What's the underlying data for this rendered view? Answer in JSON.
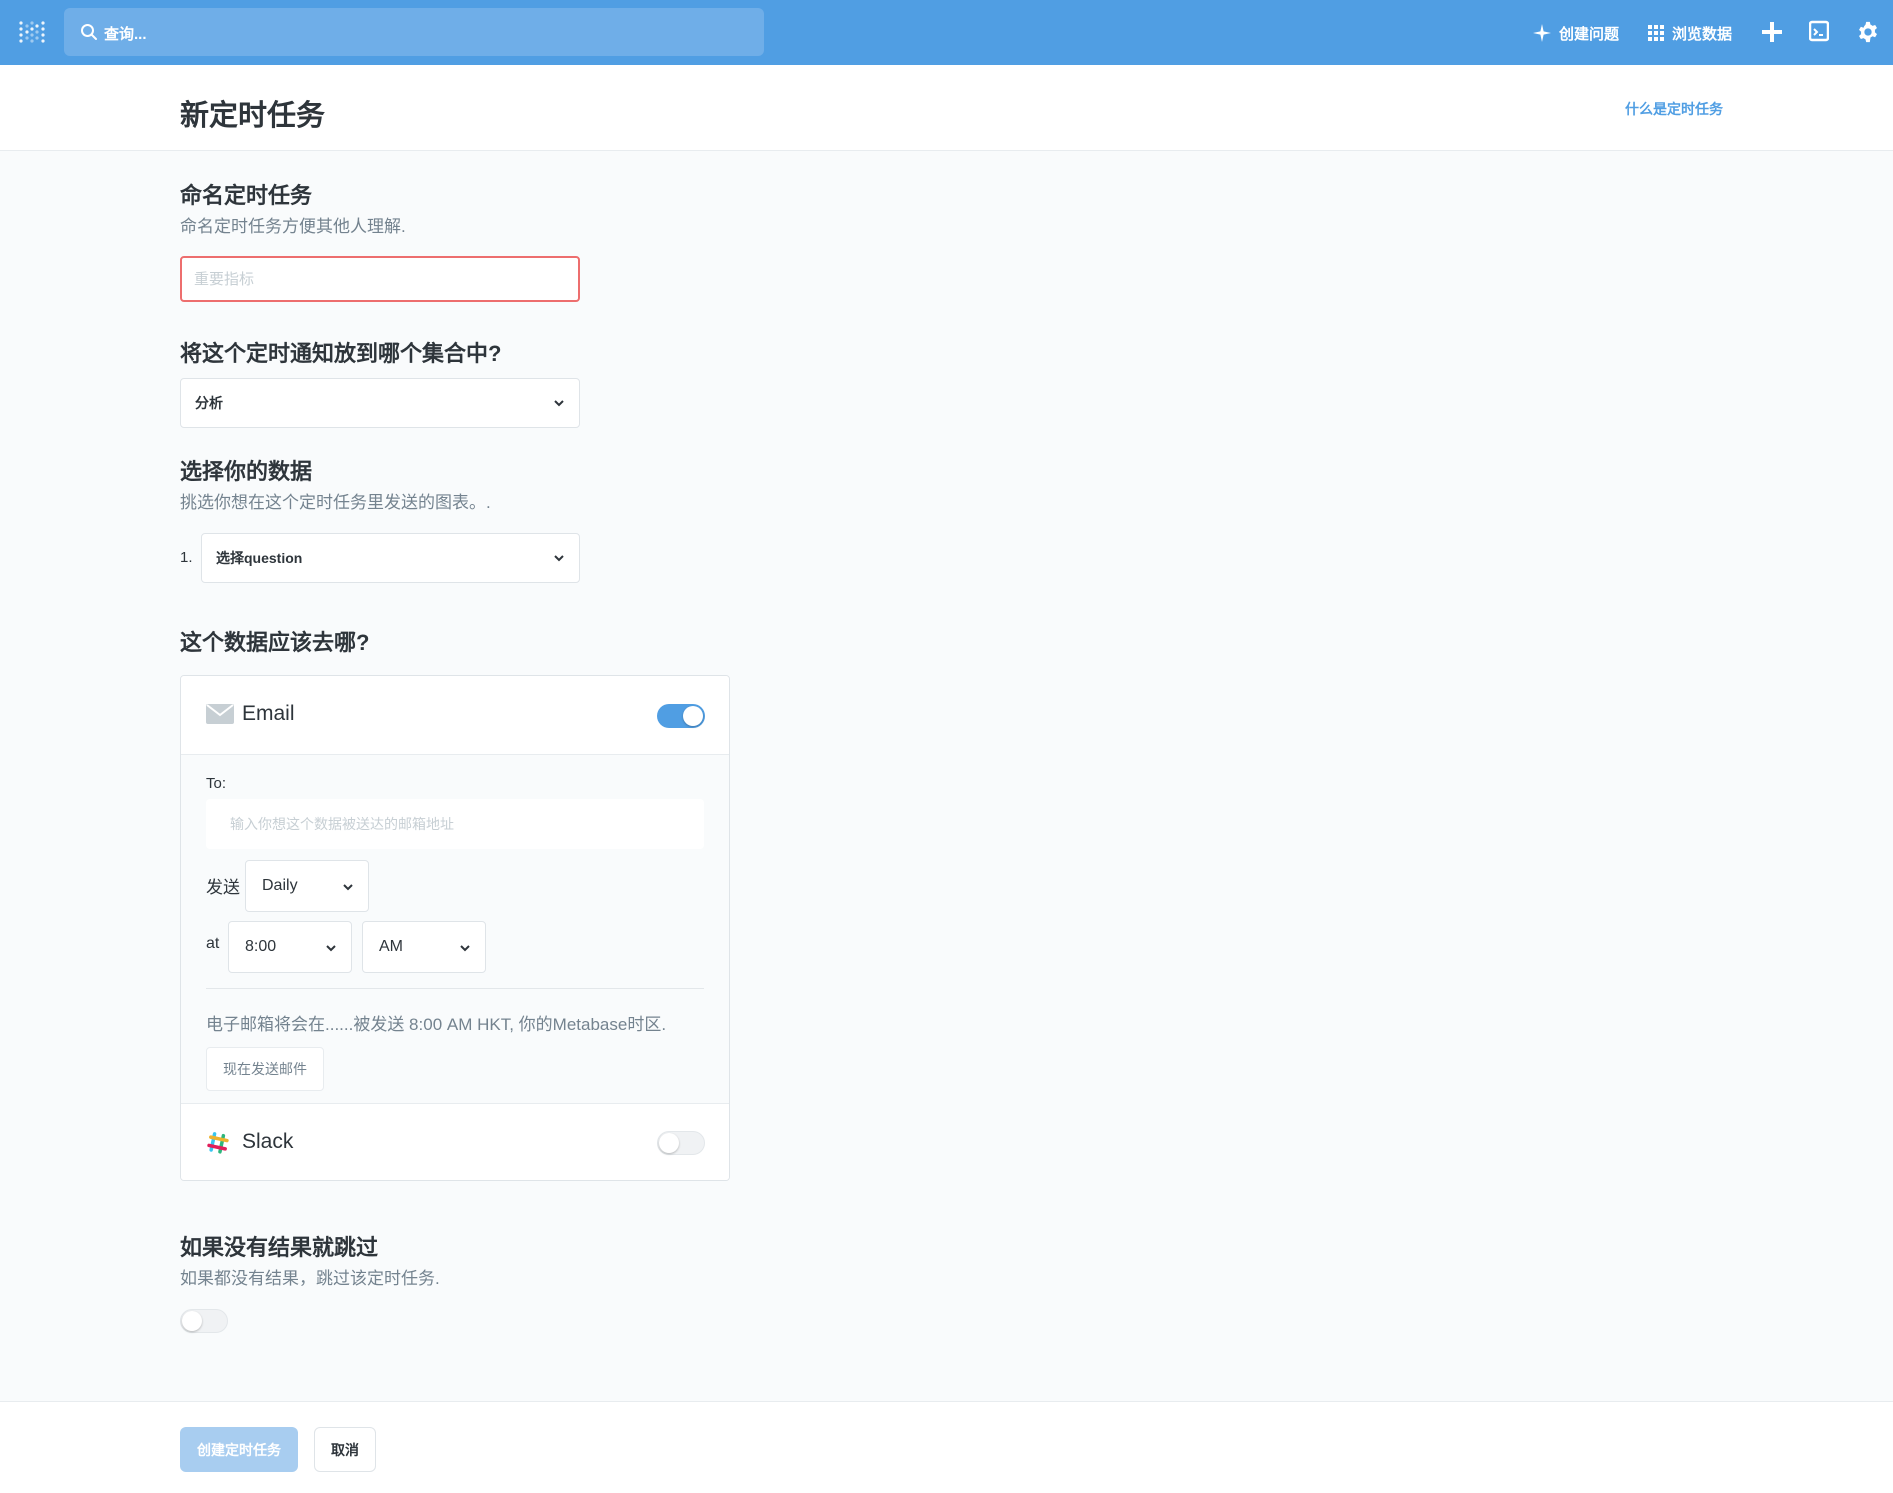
{
  "nav": {
    "search_placeholder": "查询...",
    "create_question": "创建问题",
    "browse_data": "浏览数据"
  },
  "header": {
    "title": "新定时任务",
    "help_link": "什么是定时任务"
  },
  "name_section": {
    "title": "命名定时任务",
    "description": "命名定时任务方便其他人理解.",
    "input_placeholder": "重要指标"
  },
  "collection_section": {
    "title": "将这个定时通知放到哪个集合中?",
    "selected": "分析"
  },
  "data_section": {
    "title": "选择你的数据",
    "description": "挑选你想在这个定时任务里发送的图表。.",
    "item_number": "1.",
    "question_placeholder": "选择question"
  },
  "destination_section": {
    "title": "这个数据应该去哪?",
    "email": {
      "label": "Email",
      "enabled": true,
      "to_label": "To:",
      "to_placeholder": "输入你想这个数据被送达的邮箱地址",
      "send_label": "发送",
      "frequency": "Daily",
      "at_label": "at",
      "time": "8:00",
      "ampm": "AM",
      "note": "电子邮箱将会在......被发送 8:00 AM HKT, 你的Metabase时区.",
      "send_now": "现在发送邮件"
    },
    "slack": {
      "label": "Slack",
      "enabled": false
    }
  },
  "skip_section": {
    "title": "如果没有结果就跳过",
    "description": "如果都没有结果，跳过该定时任务.",
    "enabled": false
  },
  "footer": {
    "create_button": "创建定时任务",
    "cancel_button": "取消"
  },
  "colors": {
    "brand": "#509ee3",
    "error_border": "#ed6e6e",
    "text_dark": "#2e353b",
    "text_medium": "#74838f"
  }
}
